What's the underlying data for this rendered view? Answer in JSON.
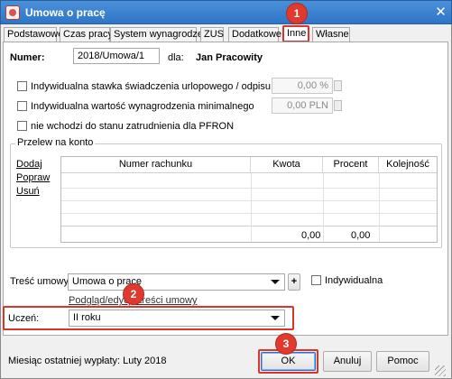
{
  "window": {
    "title": "Umowa o pracę",
    "close_symbol": "✕"
  },
  "tabs": [
    "Podstawowe",
    "Czas pracy",
    "System wynagrodzeń",
    "ZUS",
    "Dodatkowe",
    "Inne",
    "Własne"
  ],
  "active_tab": "Inne",
  "numer": {
    "label": "Numer:",
    "value": "2018/Umowa/1",
    "dla_label": "dla:",
    "person": "Jan Pracowity"
  },
  "options": {
    "stawka_label": "Indywidualna stawka świadczenia urlopowego / odpisu na ZFŚS",
    "stawka_value": "0,00 %",
    "wynagrodzenie_label": "Indywidualna wartość wynagrodzenia minimalnego",
    "wynagrodzenie_value": "0,00 PLN",
    "pfron_label": "nie wchodzi do stanu zatrudnienia dla PFRON"
  },
  "przelew": {
    "title": "Przelew na konto",
    "actions": [
      "Dodaj",
      "Popraw",
      "Usuń"
    ],
    "columns": [
      "Numer rachunku",
      "Kwota",
      "Procent",
      "Kolejność"
    ],
    "total_kwota": "0,00",
    "total_procent": "0,00"
  },
  "tresc": {
    "label": "Treść umowy:",
    "value": "Umowa o pracę",
    "add_symbol": "+",
    "individual_label": "Indywidualna",
    "preview_link": "Podgląd/edycja treści umowy"
  },
  "uczen": {
    "label": "Uczeń:",
    "value": "II roku"
  },
  "footer": {
    "status": "Miesiąc ostatniej wypłaty: Luty 2018",
    "ok": "OK",
    "cancel": "Anuluj",
    "help": "Pomoc"
  },
  "annotations": [
    "1",
    "2",
    "3"
  ],
  "colors": {
    "titlebar": "#3a82d0",
    "annotation": "#e03a2f"
  }
}
